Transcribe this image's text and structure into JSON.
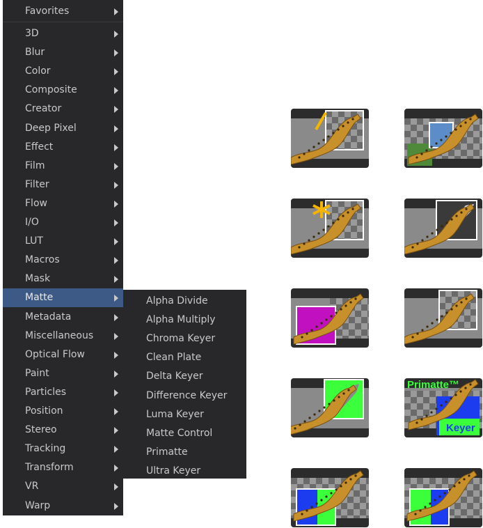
{
  "menu": {
    "favorites": "Favorites",
    "items": [
      "3D",
      "Blur",
      "Color",
      "Composite",
      "Creator",
      "Deep Pixel",
      "Effect",
      "Film",
      "Filter",
      "Flow",
      "I/O",
      "LUT",
      "Macros",
      "Mask",
      "Matte",
      "Metadata",
      "Miscellaneous",
      "Optical Flow",
      "Paint",
      "Particles",
      "Position",
      "Stereo",
      "Tracking",
      "Transform",
      "VR",
      "Warp"
    ],
    "active": "Matte"
  },
  "submenu": {
    "items": [
      "Alpha Divide",
      "Alpha Multiply",
      "Chroma Keyer",
      "Clean Plate",
      "Delta Keyer",
      "Difference Keyer",
      "Luma Keyer",
      "Matte Control",
      "Primatte",
      "Ultra Keyer"
    ]
  },
  "tiles": [
    {
      "name": "alpha-divide-tile",
      "icon": "alpha-divide-icon"
    },
    {
      "name": "alpha-multiply-tile",
      "icon": "alpha-multiply-icon"
    },
    {
      "name": "chroma-keyer-tile",
      "icon": "chroma-keyer-icon"
    },
    {
      "name": "clean-plate-tile",
      "icon": "clean-plate-icon"
    },
    {
      "name": "delta-keyer-tile",
      "icon": "delta-keyer-icon"
    },
    {
      "name": "difference-keyer-tile",
      "icon": "difference-keyer-icon"
    },
    {
      "name": "luma-keyer-tile",
      "icon": "luma-keyer-icon"
    },
    {
      "name": "primatte-tile",
      "icon": "primatte-icon",
      "texts": [
        "Primatte™",
        "Keyer"
      ]
    },
    {
      "name": "matte-control-tile",
      "icon": "matte-control-icon"
    },
    {
      "name": "ultra-keyer-tile",
      "icon": "ultra-keyer-icon"
    }
  ],
  "colors": {
    "menu_bg": "#28282b",
    "highlight": "#3d5a86",
    "text": "#c9c9c9"
  }
}
